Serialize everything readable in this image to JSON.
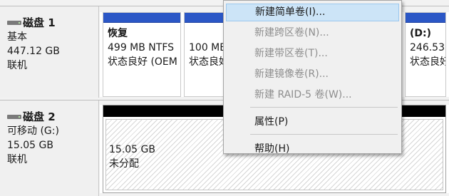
{
  "disks": [
    {
      "title": "磁盘 1",
      "type": "基本",
      "size": "447.12 GB",
      "status": "联机",
      "partitions": [
        {
          "name": "恢复",
          "size": "499 MB NTFS",
          "status": "状态良好 (OEM"
        },
        {
          "name": "",
          "size": "100 MB",
          "status": "状态良好"
        },
        {
          "name": "(D:)",
          "size": "246.53 GB",
          "status": "状态良好"
        }
      ]
    },
    {
      "title": "磁盘 2",
      "type": "可移动 (G:)",
      "size": "15.05 GB",
      "status": "联机",
      "unallocated": {
        "size": "15.05 GB",
        "label": "未分配"
      }
    }
  ],
  "context_menu": {
    "items": [
      {
        "label": "新建简单卷(I)...",
        "enabled": true,
        "highlighted": true
      },
      {
        "label": "新建跨区卷(N)...",
        "enabled": false
      },
      {
        "label": "新建带区卷(T)...",
        "enabled": false
      },
      {
        "label": "新建镜像卷(R)...",
        "enabled": false
      },
      {
        "label": "新建 RAID-5 卷(W)...",
        "enabled": false
      },
      {
        "label": "属性(P)",
        "enabled": true
      },
      {
        "label": "帮助(H)",
        "enabled": true
      }
    ]
  },
  "colors": {
    "primary_partition_bar": "#2b57c6",
    "unallocated_bar": "#000000",
    "menu_highlight": "#cce4f7"
  },
  "icons": {
    "disk": "disk-drive-icon"
  }
}
